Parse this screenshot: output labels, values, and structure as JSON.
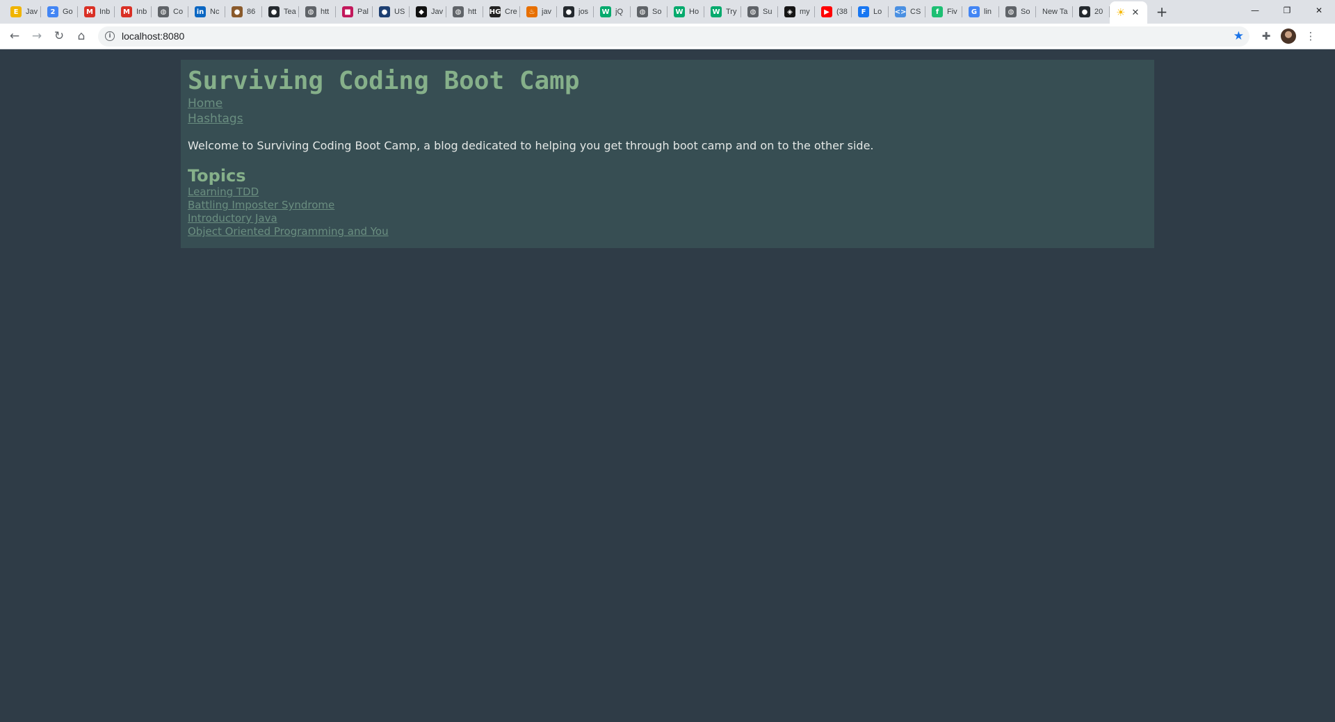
{
  "browser": {
    "tabs": [
      {
        "label": "Jav",
        "icon": "ejs-icon",
        "color": "#f0b400",
        "glyph": "E"
      },
      {
        "label": "Go",
        "icon": "calendar-icon",
        "color": "#4285f4",
        "glyph": "2"
      },
      {
        "label": "Inb",
        "icon": "gmail-icon",
        "color": "#d93025",
        "glyph": "M"
      },
      {
        "label": "Inb",
        "icon": "gmail-icon",
        "color": "#d93025",
        "glyph": "M"
      },
      {
        "label": "Co",
        "icon": "globe-icon",
        "color": "#5f6368",
        "glyph": "◍"
      },
      {
        "label": "Nc",
        "icon": "linkedin-icon",
        "color": "#0a66c2",
        "glyph": "in"
      },
      {
        "label": "86",
        "icon": "cookie-icon",
        "color": "#8a5a2b",
        "glyph": "●"
      },
      {
        "label": "Tea",
        "icon": "github-icon",
        "color": "#24292e",
        "glyph": "●"
      },
      {
        "label": "htt",
        "icon": "globe-icon",
        "color": "#5f6368",
        "glyph": "◍"
      },
      {
        "label": "Pal",
        "icon": "palette-icon",
        "color": "#c2185b",
        "glyph": "■"
      },
      {
        "label": "US",
        "icon": "uscis-icon",
        "color": "#1d3f72",
        "glyph": "●"
      },
      {
        "label": "Jav",
        "icon": "codewars-icon",
        "color": "#111111",
        "glyph": "◆"
      },
      {
        "label": "htt",
        "icon": "globe-icon",
        "color": "#5f6368",
        "glyph": "◍"
      },
      {
        "label": "Cre",
        "icon": "hg-icon",
        "color": "#222222",
        "glyph": "HG"
      },
      {
        "label": "jav",
        "icon": "java-icon",
        "color": "#e76f00",
        "glyph": "♨"
      },
      {
        "label": "jos",
        "icon": "github-icon",
        "color": "#24292e",
        "glyph": "●"
      },
      {
        "label": "jQ",
        "icon": "w3schools-icon",
        "color": "#04aa6d",
        "glyph": "W"
      },
      {
        "label": "So",
        "icon": "globe-icon",
        "color": "#5f6368",
        "glyph": "◍"
      },
      {
        "label": "Ho",
        "icon": "w3schools-icon",
        "color": "#04aa6d",
        "glyph": "W"
      },
      {
        "label": "Try",
        "icon": "w3schools-icon",
        "color": "#04aa6d",
        "glyph": "W"
      },
      {
        "label": "Su",
        "icon": "globe-icon",
        "color": "#5f6368",
        "glyph": "◍"
      },
      {
        "label": "my",
        "icon": "codesandbox-icon",
        "color": "#151515",
        "glyph": "◈"
      },
      {
        "label": "(38",
        "icon": "youtube-icon",
        "color": "#ff0000",
        "glyph": "▶"
      },
      {
        "label": "Lo",
        "icon": "facebook-icon",
        "color": "#1877f2",
        "glyph": "F"
      },
      {
        "label": "CS",
        "icon": "code-icon",
        "color": "#4a90e2",
        "glyph": "<>"
      },
      {
        "label": "Fiv",
        "icon": "fiverr-icon",
        "color": "#1dbf73",
        "glyph": "f"
      },
      {
        "label": "lin",
        "icon": "google-icon",
        "color": "#4285f4",
        "glyph": "G"
      },
      {
        "label": "So",
        "icon": "globe-icon",
        "color": "#5f6368",
        "glyph": "◍"
      },
      {
        "label": "New Ta",
        "icon": "",
        "color": "",
        "glyph": ""
      },
      {
        "label": "20",
        "icon": "github-icon",
        "color": "#24292e",
        "glyph": "●"
      }
    ],
    "active_tab": {
      "icon": "sun-icon",
      "glyph": "☀",
      "color": "#f6b800"
    },
    "url": "localhost:8080"
  },
  "page": {
    "title": "Surviving Coding Boot Camp",
    "nav": {
      "home": "Home",
      "hashtags": "Hashtags"
    },
    "welcome": "Welcome to Surviving Coding Boot Camp, a blog dedicated to helping you get through boot camp and on to the other side.",
    "topics_heading": "Topics",
    "topics": [
      "Learning TDD",
      "Battling Imposter Syndrome",
      "Introductory Java",
      "Object Oriented Programming and You"
    ]
  },
  "colors": {
    "page_bg": "#2f3c47",
    "container_bg": "#374e53",
    "heading": "#86b08a",
    "link": "#6a8e80",
    "text": "#e4e8e6"
  }
}
